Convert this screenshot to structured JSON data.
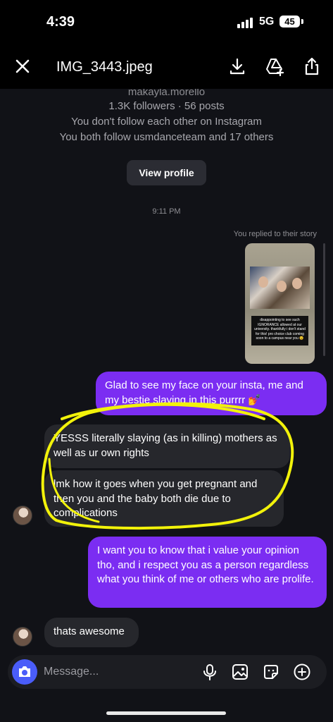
{
  "status_bar": {
    "time": "4:39",
    "network": "5G",
    "battery": "45"
  },
  "viewer": {
    "title": "IMG_3443.jpeg"
  },
  "profile": {
    "username": "makayla.morello",
    "stats": "1.3K followers · 56 posts",
    "follow_status": "You don't follow each other on Instagram",
    "mutuals": "You both follow usmdanceteam and 17 others",
    "view_profile_label": "View profile"
  },
  "chat": {
    "timestamp": "9:11 PM",
    "replied_note": "You replied to their story",
    "story_caption": "disappointing to see such IGNORANCE allowed at our university. thankfully i don't stand for this! pro choice club coming soon to a campus near you 😉",
    "messages": [
      {
        "from": "me",
        "text": "Glad to see my face on your insta, me and my bestie slaying in this purrrr 💅"
      },
      {
        "from": "them",
        "text": "YESSS literally slaying (as in killing) mothers as well as ur own rights"
      },
      {
        "from": "them",
        "text": "lmk how it goes when you get pregnant and then you and the baby both die due to complications"
      },
      {
        "from": "me",
        "text": "I want you to know that i value your opinion tho, and i respect you as a person regardless what you think of me or others who are prolife."
      },
      {
        "from": "them",
        "text": "thats awesome"
      }
    ]
  },
  "composer": {
    "placeholder": "Message..."
  },
  "colors": {
    "sent_bubble": "#7b2df2",
    "received_bubble": "#26272c",
    "camera_button": "#4a5df9",
    "highlight": "#f2f20a"
  }
}
